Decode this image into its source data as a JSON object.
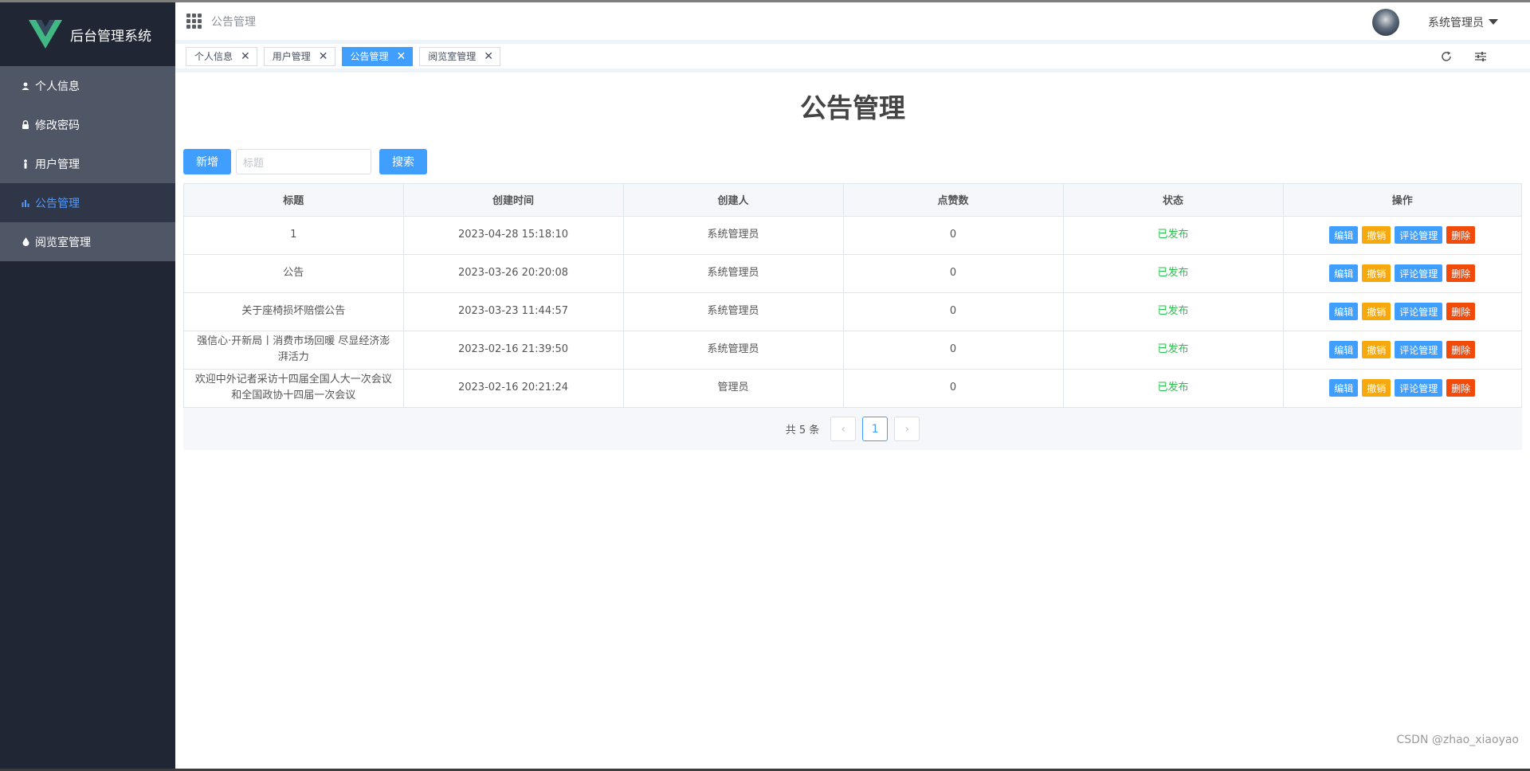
{
  "app": {
    "title": "后台管理系统"
  },
  "sidebar": {
    "items": [
      {
        "label": "个人信息",
        "icon": "user-icon"
      },
      {
        "label": "修改密码",
        "icon": "lock-icon"
      },
      {
        "label": "用户管理",
        "icon": "person-icon"
      },
      {
        "label": "公告管理",
        "icon": "bar-chart-icon",
        "active": true
      },
      {
        "label": "阅览室管理",
        "icon": "drop-icon"
      }
    ]
  },
  "header": {
    "breadcrumb": "公告管理",
    "user_name": "系统管理员"
  },
  "tabs": [
    {
      "label": "个人信息"
    },
    {
      "label": "用户管理"
    },
    {
      "label": "公告管理",
      "active": true
    },
    {
      "label": "阅览室管理"
    }
  ],
  "page": {
    "title": "公告管理",
    "add_label": "新增",
    "search_placeholder": "标题",
    "search_label": "搜索"
  },
  "table": {
    "columns": [
      "标题",
      "创建时间",
      "创建人",
      "点赞数",
      "状态",
      "操作"
    ],
    "actions": {
      "edit": "编辑",
      "revoke": "撤销",
      "comments": "评论管理",
      "delete": "删除"
    },
    "rows": [
      {
        "title": "1",
        "created": "2023-04-28 15:18:10",
        "creator": "系统管理员",
        "likes": "0",
        "status": "已发布"
      },
      {
        "title": "公告",
        "created": "2023-03-26 20:20:08",
        "creator": "系统管理员",
        "likes": "0",
        "status": "已发布"
      },
      {
        "title": "关于座椅损坏赔偿公告",
        "created": "2023-03-23 11:44:57",
        "creator": "系统管理员",
        "likes": "0",
        "status": "已发布"
      },
      {
        "title": "强信心·开新局丨消费市场回暖 尽显经济澎湃活力",
        "created": "2023-02-16 21:39:50",
        "creator": "系统管理员",
        "likes": "0",
        "status": "已发布"
      },
      {
        "title": "欢迎中外记者采访十四届全国人大一次会议和全国政协十四届一次会议",
        "created": "2023-02-16 20:21:24",
        "creator": "管理员",
        "likes": "0",
        "status": "已发布"
      }
    ]
  },
  "pagination": {
    "total_text": "共 5 条",
    "prev": "‹",
    "current": "1",
    "next": "›"
  },
  "watermark": "CSDN @zhao_xiaoyao",
  "colors": {
    "primary": "#409eff",
    "warning": "#f7a80d",
    "danger": "#f24b09",
    "success": "#27c24c",
    "sidebar": "#202634"
  }
}
